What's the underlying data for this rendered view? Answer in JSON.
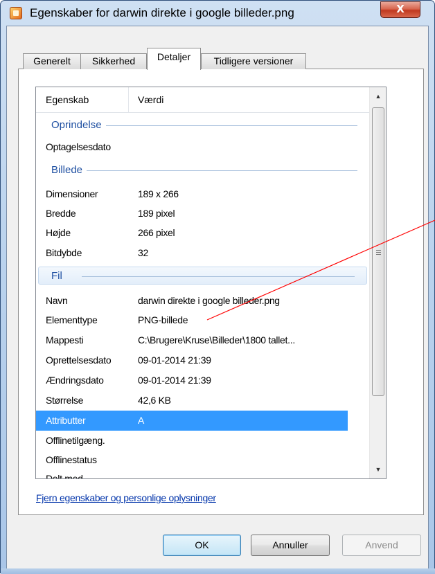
{
  "window": {
    "title": "Egenskaber for darwin direkte i google billeder.png",
    "close_label": "X",
    "icon": "file-properties-icon"
  },
  "tabs": [
    {
      "label": "Generelt",
      "active": false
    },
    {
      "label": "Sikkerhed",
      "active": false
    },
    {
      "label": "Detaljer",
      "active": true
    },
    {
      "label": "Tidligere versioner",
      "active": false
    }
  ],
  "list": {
    "col_property": "Egenskab",
    "col_value": "Værdi",
    "groups": {
      "origin": "Oprindelse",
      "image": "Billede",
      "file": "Fil"
    },
    "rows": {
      "date_taken": {
        "key": "Optagelsesdato",
        "value": ""
      },
      "dimensions": {
        "key": "Dimensioner",
        "value": "189 x 266"
      },
      "width": {
        "key": "Bredde",
        "value": "189 pixel"
      },
      "height": {
        "key": "Højde",
        "value": "266 pixel"
      },
      "bit_depth": {
        "key": "Bitdybde",
        "value": "32"
      },
      "name": {
        "key": "Navn",
        "value": "darwin direkte i google billeder.png"
      },
      "item_type": {
        "key": "Elementtype",
        "value": "PNG-billede"
      },
      "folder_path": {
        "key": "Mappesti",
        "value": "C:\\Brugere\\Kruse\\Billeder\\1800 tallet..."
      },
      "created": {
        "key": "Oprettelsesdato",
        "value": "09-01-2014 21:39"
      },
      "modified": {
        "key": "Ændringsdato",
        "value": "09-01-2014 21:39"
      },
      "size": {
        "key": "Størrelse",
        "value": "42,6 KB"
      },
      "attributes": {
        "key": "Attributter",
        "value": "A",
        "selected": true
      },
      "offline_avail": {
        "key": "Offlinetilgæng.",
        "value": ""
      },
      "offline_status": {
        "key": "Offlinestatus",
        "value": ""
      },
      "shared_with": {
        "key": "Delt med",
        "value": ""
      }
    }
  },
  "remove_link": "Fjern egenskaber og personlige oplysninger",
  "buttons": {
    "ok": "OK",
    "cancel": "Annuller",
    "apply": "Anvend"
  },
  "colors": {
    "selection": "#3399ff",
    "group_label": "#1e4fa1",
    "link": "#0033aa",
    "annotation_line": "#ff0000"
  }
}
